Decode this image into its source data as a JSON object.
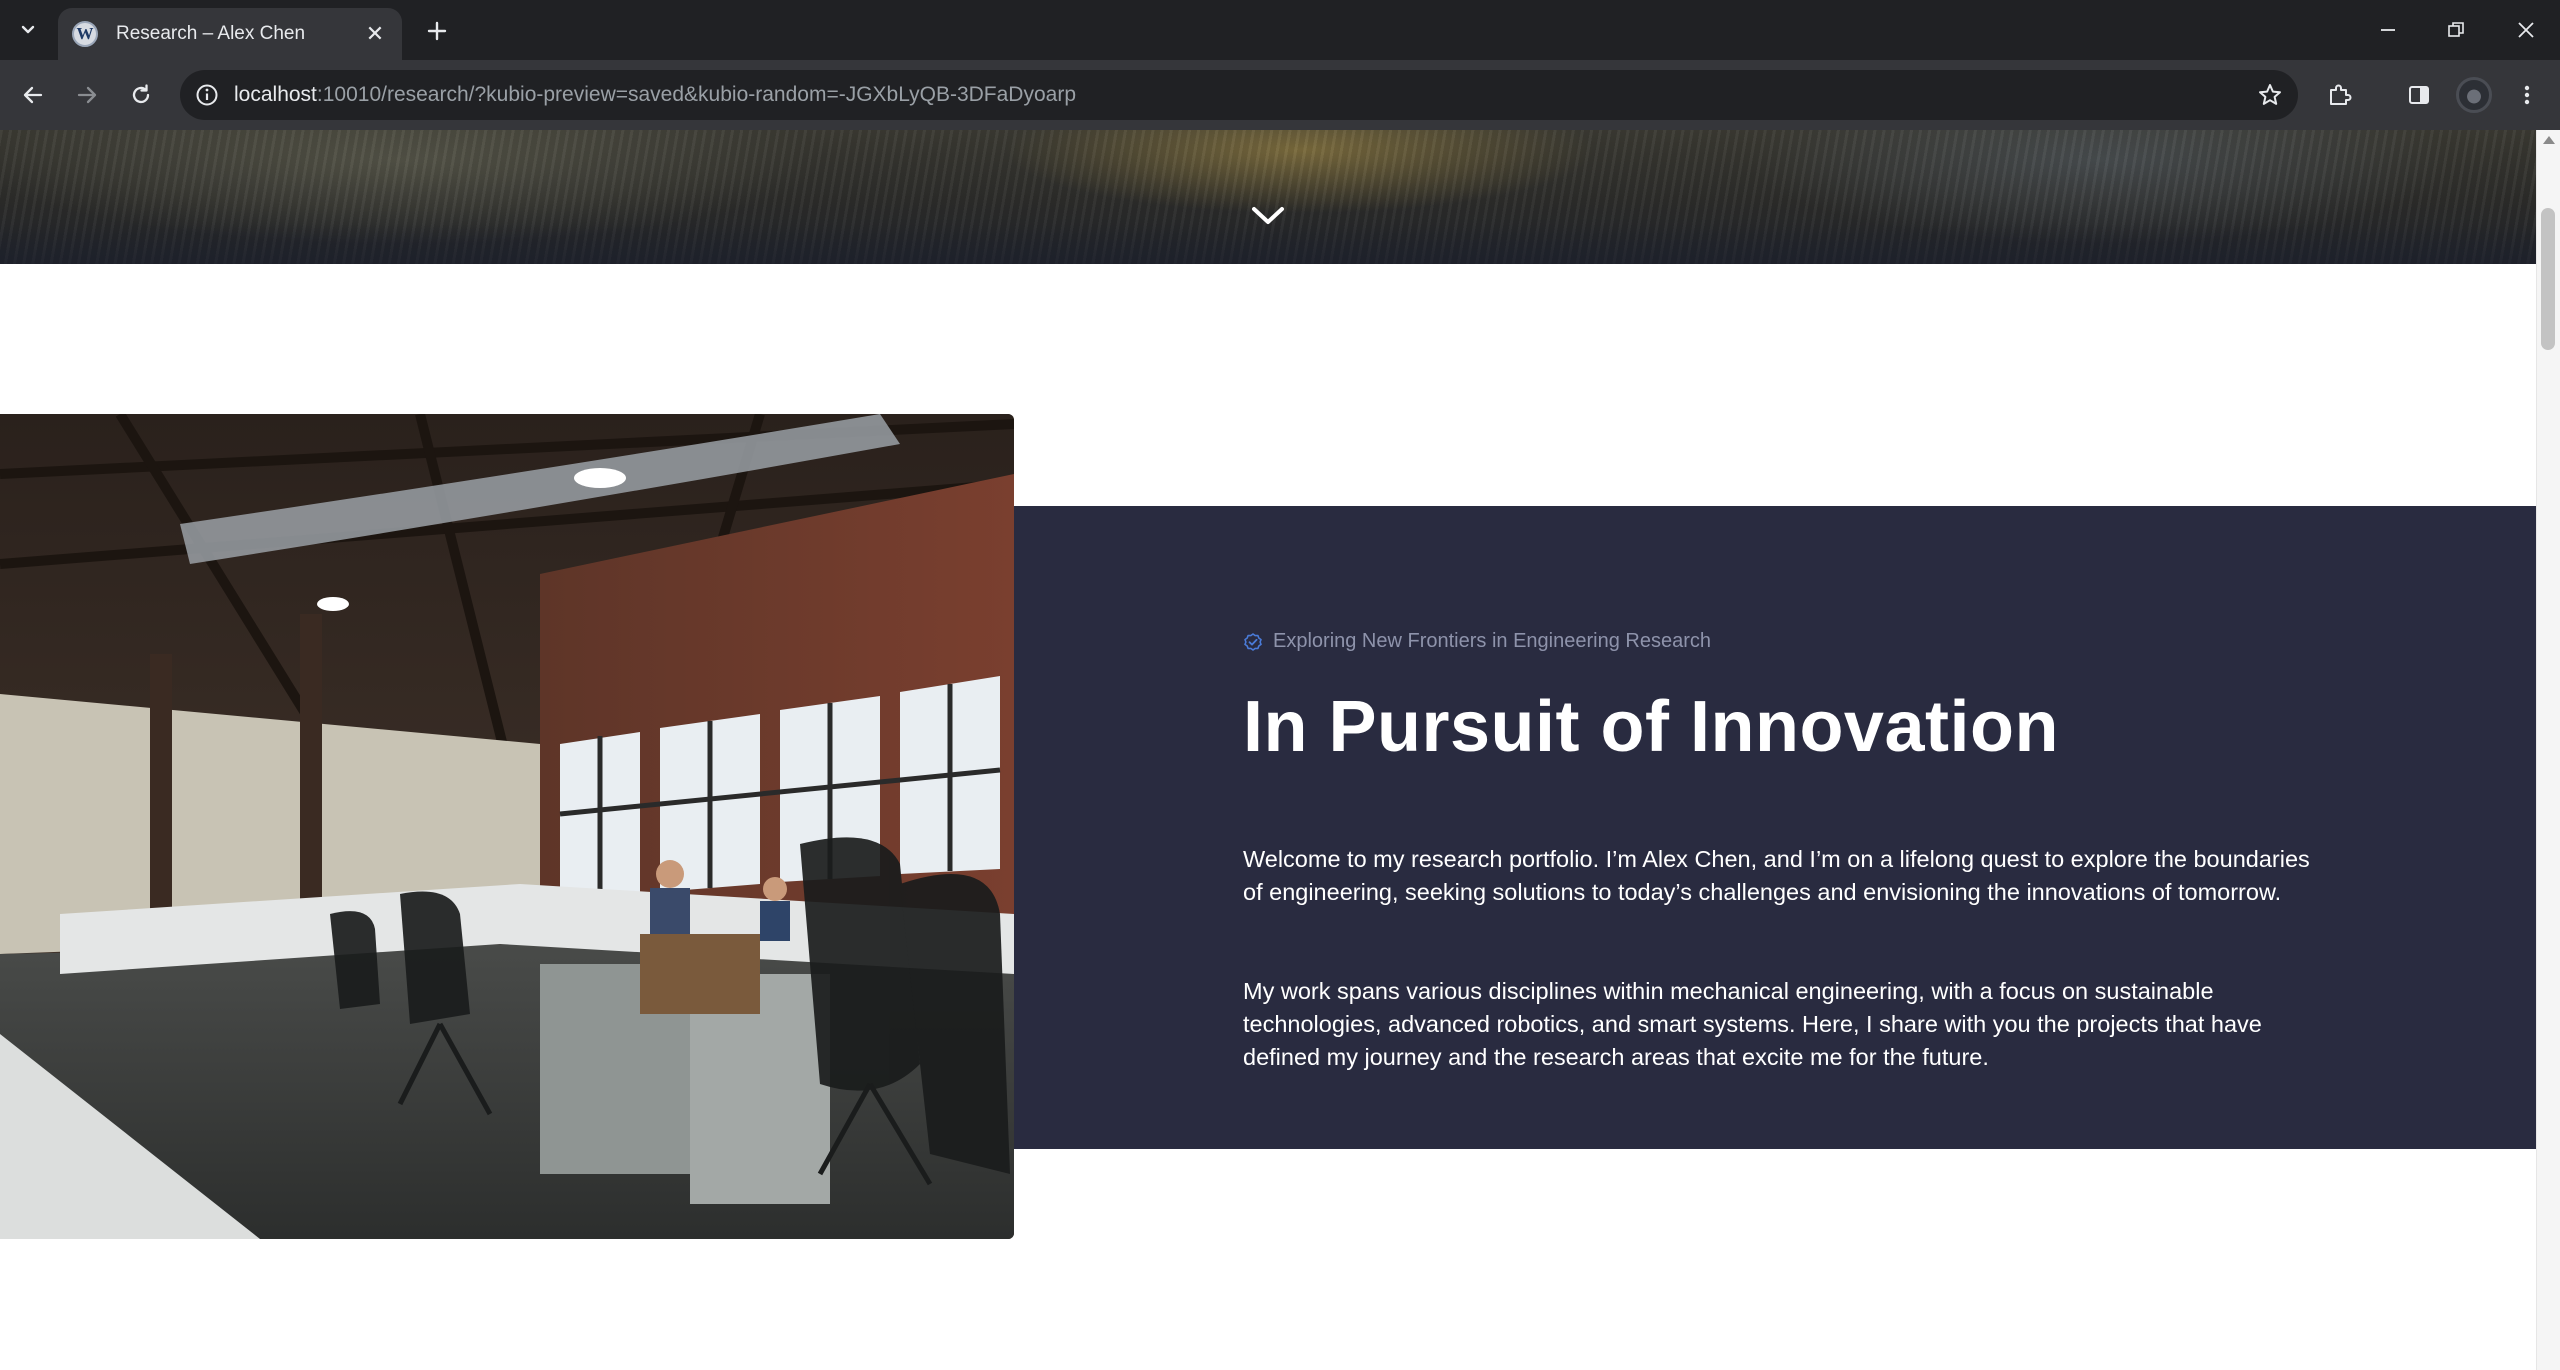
{
  "browser": {
    "tab_title": "Research – Alex Chen",
    "url_host": "localhost",
    "url_path": ":10010/research/?kubio-preview=saved&kubio-random=-JGXbLyQB-3DFaDyoarp"
  },
  "icons": {
    "tab_search": "chevron-down-icon",
    "favicon": "wordpress-icon",
    "scroll_down": "chevron-down-icon",
    "kicker": "check-circle-icon"
  },
  "about": {
    "kicker": "Exploring New Frontiers in Engineering Research",
    "heading": "In Pursuit of Innovation",
    "paragraph1": "Welcome to my research portfolio. I’m Alex Chen, and I’m on a lifelong quest to explore the boundaries of engineering, seeking solutions to today’s challenges and envisioning the innovations of tomorrow.",
    "paragraph2": "My work spans various disciplines within mechanical engineering, with a focus on sustainable technologies, advanced robotics, and smart systems. Here, I share with you the projects that have defined my journey and the research areas that excite me for the future."
  },
  "colors": {
    "panel_bg": "#292b40",
    "kicker_text": "#8e93ab",
    "kicker_icon": "#4a7bd8",
    "chrome_dark": "#202124",
    "chrome_toolbar": "#35363a"
  }
}
